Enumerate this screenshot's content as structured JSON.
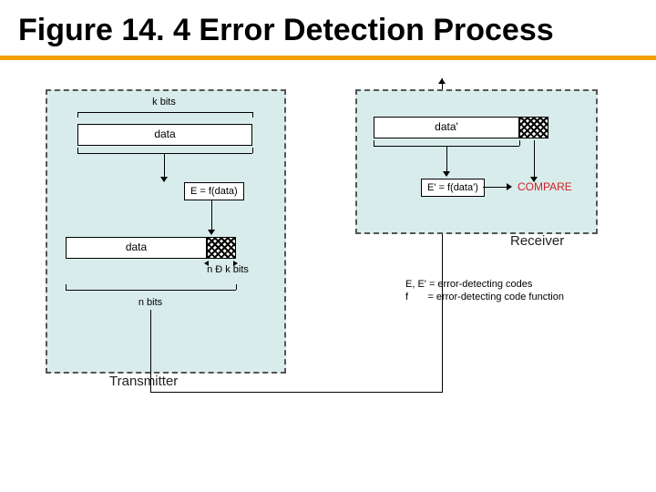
{
  "title": "Figure 14. 4 Error Detection Process",
  "transmitter": {
    "label": "Transmitter",
    "k_bits_label": "k bits",
    "data_label_top": "data",
    "formula": "E = f(data)",
    "data_label_bottom": "data",
    "nk_bits_label": "n Ð k bits",
    "n_bits_label": "n bits"
  },
  "receiver": {
    "label": "Receiver",
    "data_label": "data'",
    "formula": "E' = f(data')",
    "compare": "COMPARE"
  },
  "legend_line1": "E, E' = error-detecting codes",
  "legend_line2": "f       = error-detecting code function"
}
